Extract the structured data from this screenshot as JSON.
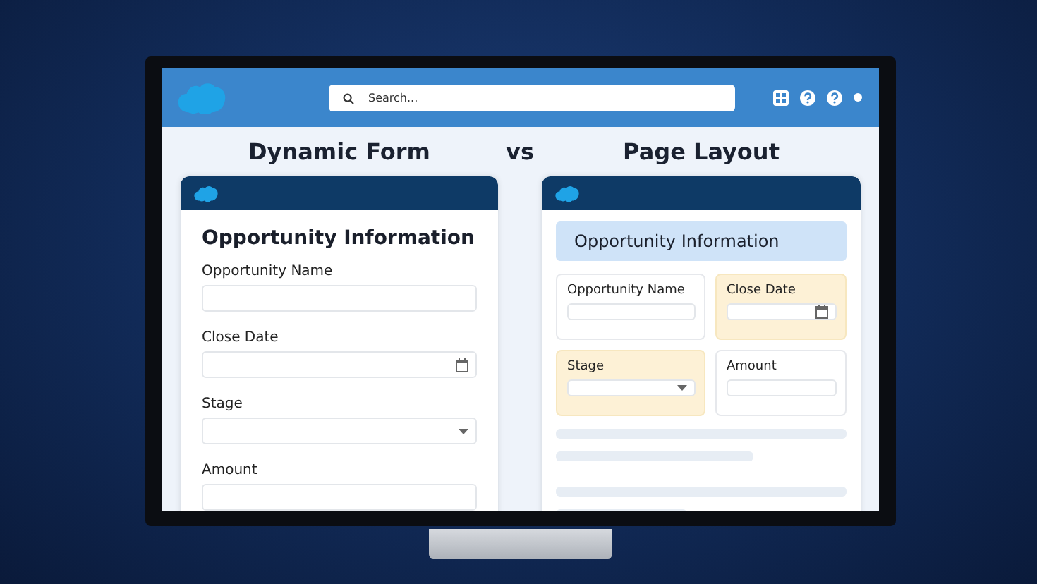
{
  "search": {
    "placeholder": "Search..."
  },
  "titles": {
    "left": "Dynamic Form",
    "separator": "vs",
    "right": "Page Layout"
  },
  "dynamic_form": {
    "section_title": "Opportunity Information",
    "fields": [
      {
        "label": "Opportunity Name",
        "kind": "text"
      },
      {
        "label": "Close Date",
        "kind": "date"
      },
      {
        "label": "Stage",
        "kind": "select"
      },
      {
        "label": "Amount",
        "kind": "text"
      }
    ]
  },
  "page_layout": {
    "section_title": "Opportunity Information",
    "fields": [
      {
        "label": "Opportunity Name",
        "kind": "text",
        "highlighted": false
      },
      {
        "label": "Close Date",
        "kind": "date",
        "highlighted": true
      },
      {
        "label": "Stage",
        "kind": "select",
        "highlighted": true
      },
      {
        "label": "Amount",
        "kind": "text",
        "highlighted": false
      }
    ]
  }
}
